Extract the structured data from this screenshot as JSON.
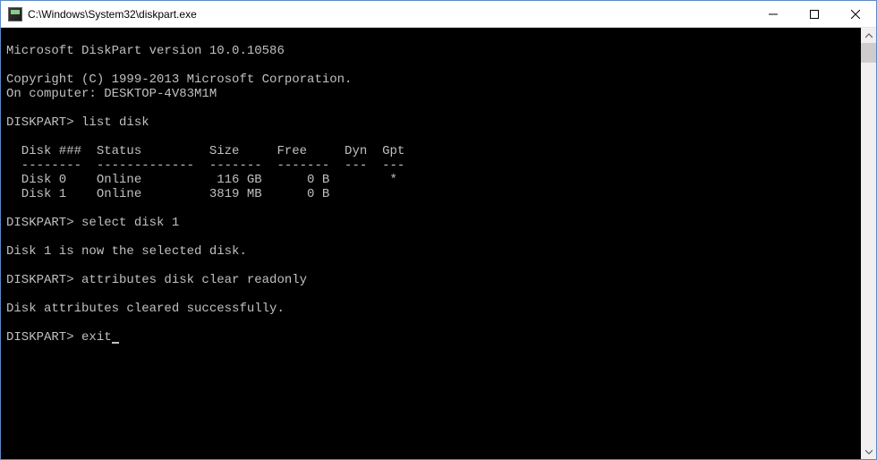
{
  "window": {
    "title": "C:\\Windows\\System32\\diskpart.exe"
  },
  "console": {
    "blank0": "",
    "version_line": "Microsoft DiskPart version 10.0.10586",
    "blank1": "",
    "copyright": "Copyright (C) 1999-2013 Microsoft Corporation.",
    "computer": "On computer: DESKTOP-4V83M1M",
    "blank2": "",
    "prompt1": "DISKPART> list disk",
    "blank3": "",
    "header": "  Disk ###  Status         Size     Free     Dyn  Gpt",
    "divider": "  --------  -------------  -------  -------  ---  ---",
    "row0": "  Disk 0    Online          116 GB      0 B        *",
    "row1": "  Disk 1    Online         3819 MB      0 B",
    "blank4": "",
    "prompt2": "DISKPART> select disk 1",
    "blank5": "",
    "msg_selected": "Disk 1 is now the selected disk.",
    "blank6": "",
    "prompt3": "DISKPART> attributes disk clear readonly",
    "blank7": "",
    "msg_cleared": "Disk attributes cleared successfully.",
    "blank8": "",
    "prompt4": "DISKPART> exit"
  }
}
